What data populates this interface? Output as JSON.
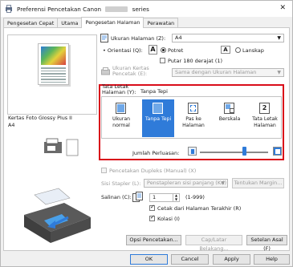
{
  "window": {
    "title_prefix": "Preferensi Pencetakan Canon",
    "title_suffix": "series",
    "close_glyph": "✕"
  },
  "tabs": [
    {
      "label": "Pengesetan Cepat"
    },
    {
      "label": "Utama"
    },
    {
      "label": "Pengesetan Halaman"
    },
    {
      "label": "Perawatan"
    }
  ],
  "active_tab": "Pengesetan Halaman",
  "preview": {
    "media_line1": "Kertas Foto Glossy Plus II",
    "media_line2": "A4"
  },
  "page_size": {
    "label": "Ukuran Halaman (Z):",
    "value": "A4"
  },
  "orientation": {
    "label": "Orientasi (Q):",
    "portrait": "Potret",
    "landscape": "Lanskap",
    "selected": "Potret",
    "rotate_label": "Putar 180 derajat (1)",
    "rotate_checked": false
  },
  "printer_paper": {
    "label_line1": "Ukuran Kertas",
    "label_line2": "Pencetak (E):",
    "value": "Sama dengan Ukuran Halaman"
  },
  "layout": {
    "label_line1": "Tata Letak",
    "label_line2": "Halaman (Y):",
    "current": "Tanpa Tepi",
    "options": [
      {
        "label": "Ukuran normal",
        "selected": false
      },
      {
        "label": "Tanpa Tepi",
        "selected": true
      },
      {
        "label": "Pas ke Halaman",
        "selected": false
      },
      {
        "label": "Berskala",
        "selected": false
      },
      {
        "label": "Tata Letak Halaman",
        "selected": false
      }
    ],
    "layout_page_number": "2"
  },
  "extension": {
    "label": "Jumlah Perluasan:",
    "level_fraction": 0.65
  },
  "duplex": {
    "label": "Pencetakan Dupleks (Manual) (X)",
    "checked": false,
    "stapling_label": "Sisi Stapler (L):",
    "stapling_value": "Penstapleran sisi panjang (Kri)",
    "margin_button": "Tentukan Margin..."
  },
  "copies": {
    "label": "Salinan (C):",
    "value": "1",
    "range": "(1-999)",
    "last_page_first": "Cetak dari Halaman Terakhir (R)",
    "last_page_checked": true,
    "collate": "Kolasi (I)",
    "collate_checked": true
  },
  "bottom_buttons": {
    "print_options": "Opsi Pencetakan...",
    "stamp": "Cap/Latar Belakang...",
    "defaults": "Setelan Asal (F)"
  },
  "footer": {
    "ok": "OK",
    "cancel": "Cancel",
    "apply": "Apply",
    "help": "Help"
  },
  "colors": {
    "selection_blue": "#2f7bd9",
    "highlight_red": "#d90c19"
  }
}
